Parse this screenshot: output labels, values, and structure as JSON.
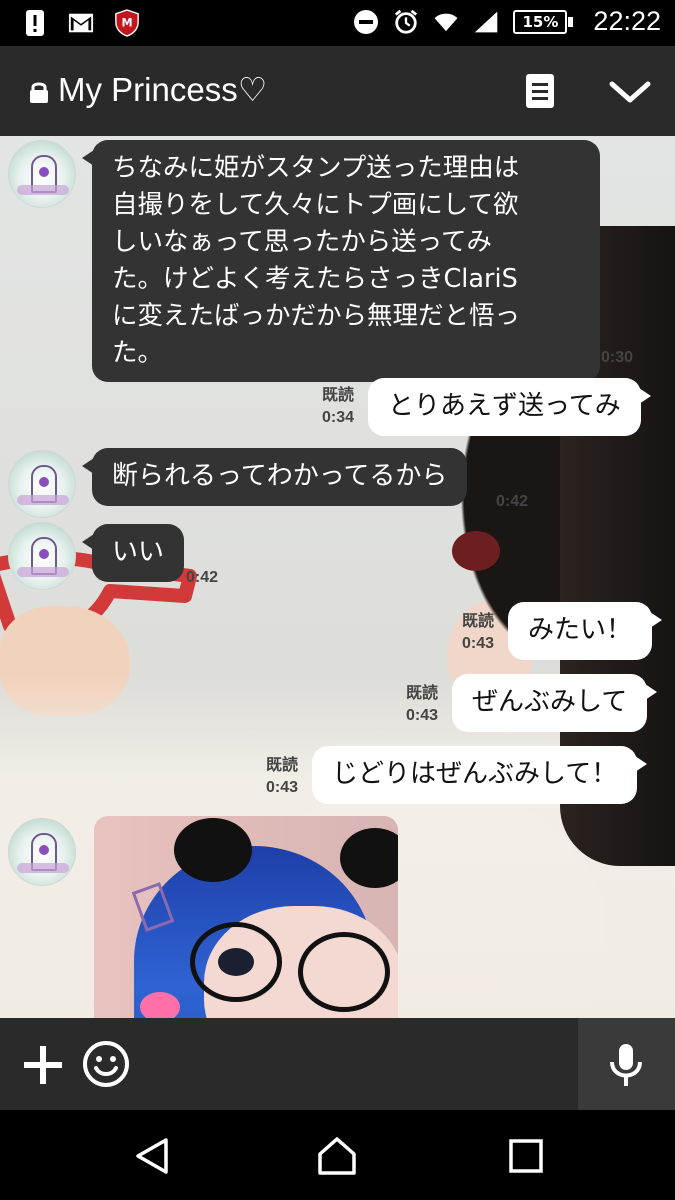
{
  "status_bar": {
    "time": "22:22",
    "battery_percent": "15%",
    "icons_left": [
      "alert-icon",
      "gmail-icon",
      "mcafee-icon"
    ],
    "icons_right": [
      "do-not-disturb-icon",
      "alarm-icon",
      "wifi-icon",
      "signal-icon",
      "battery-icon"
    ]
  },
  "header": {
    "title": "My Princess♡",
    "icons": [
      "lock-icon",
      "notes-icon",
      "chevron-down-icon"
    ]
  },
  "messages": [
    {
      "direction": "in",
      "text": "ちなみに姫がスタンプ送った理由は自撮りをして久々にトプ画にして欲しいなぁって思ったから送ってみた。けどよく考えたらさっきClariSに変えたばっかだから無理だと悟った。",
      "lines": [
        "ちなみに姫がスタンプ送った理由は",
        "自撮りをして久々にトプ画にして欲",
        "しいなぁって思ったから送ってみ",
        "た。けどよく考えたらさっきClariS",
        "に変えたばっかだから無理だと悟っ",
        "た。"
      ],
      "time": "0:30"
    },
    {
      "direction": "out",
      "text": "とりあえず送ってみ",
      "read": "既読",
      "time": "0:34"
    },
    {
      "direction": "in",
      "text": "断られるってわかってるから",
      "time": "0:42"
    },
    {
      "direction": "in",
      "text": "いい",
      "time": "0:42"
    },
    {
      "direction": "out",
      "text": "みたい！",
      "read": "既読",
      "time": "0:43"
    },
    {
      "direction": "out",
      "text": "ぜんぶみして",
      "read": "既読",
      "time": "0:43"
    },
    {
      "direction": "out",
      "text": "じどりはぜんぶみして！",
      "read": "既読",
      "time": "0:43"
    },
    {
      "direction": "in",
      "type": "image"
    }
  ],
  "input_bar": {
    "icons": [
      "plus-icon",
      "emoji-icon",
      "microphone-icon"
    ],
    "colors": {
      "bar": "#2a2a2a",
      "mic_zone": "#3a3a3a"
    }
  },
  "nav_bar": {
    "icons": [
      "back-icon",
      "home-icon",
      "recents-icon"
    ]
  },
  "colors": {
    "header_bg": "#2a2a2a",
    "incoming_bubble": "#333333",
    "outgoing_bubble": "#ffffff"
  }
}
